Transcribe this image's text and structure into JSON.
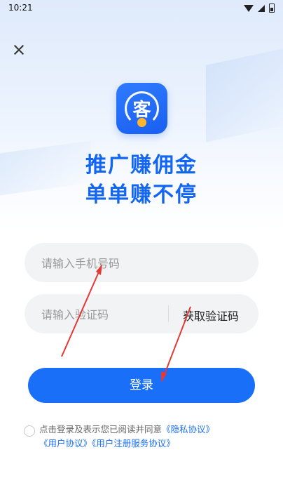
{
  "status_bar": {
    "time": "10:21"
  },
  "headline": {
    "line1": "推广赚佣金",
    "line2": "单单赚不停"
  },
  "logo": {
    "char": "客"
  },
  "form": {
    "phone_placeholder": "请输入手机号码",
    "code_placeholder": "请输入验证码",
    "get_code_label": "获取验证码",
    "login_label": "登录"
  },
  "agreement": {
    "prefix": "点击登录及表示您已阅读并同意",
    "privacy": "《隐私协议》",
    "user": "《用户协议》",
    "register_service": "《用户注册服务协议》"
  },
  "colors": {
    "primary": "#1A6FF8",
    "headline": "#1266F2",
    "annotation": "#E53935"
  },
  "icons": [
    "wifi-icon",
    "signal-icon",
    "battery-icon",
    "close-icon"
  ]
}
